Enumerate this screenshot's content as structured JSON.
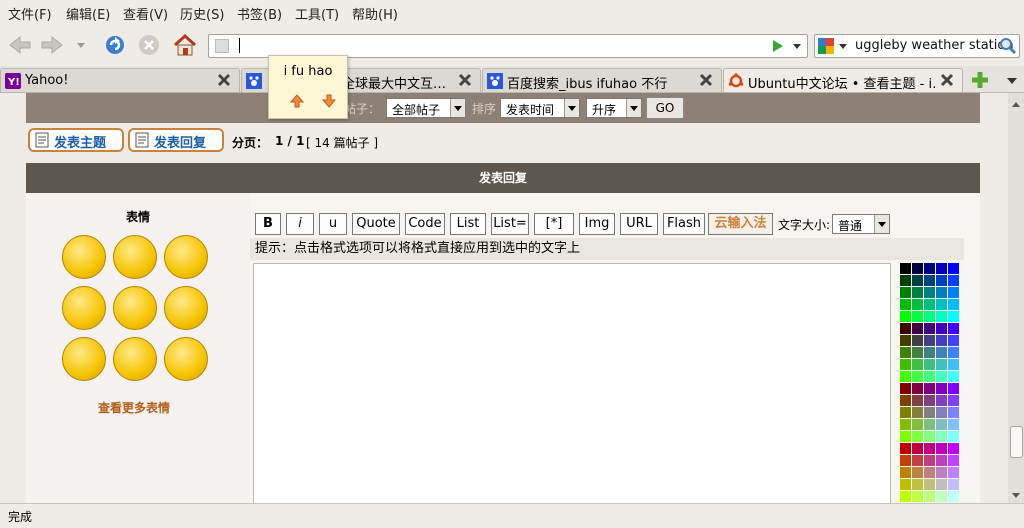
{
  "menu": [
    "文件(F)",
    "编辑(E)",
    "查看(V)",
    "历史(S)",
    "书签(B)",
    "工具(T)",
    "帮助(H)"
  ],
  "search": {
    "value": "uggleby weather station"
  },
  "tabs": [
    {
      "label": "Yahoo!"
    },
    {
      "label": "全球最大中文互…"
    },
    {
      "label": "百度搜索_ibus ifuhao 不行"
    },
    {
      "label": "Ubuntu中文论坛 • 查看主题 - i…"
    }
  ],
  "popup": {
    "text": "i fu hao"
  },
  "filter": {
    "label_posts": "帖子：",
    "posts_value": "全部帖子",
    "sort_label": "排序",
    "sort_value": "发表时间",
    "order_value": "升序",
    "go": "GO"
  },
  "actions": {
    "new_topic": "发表主题",
    "reply": "发表回复",
    "pagination_label": "分页：",
    "pagination_value": "1 / 1",
    "post_count": "[ 14 篇帖子 ]"
  },
  "reply_header": "发表回复",
  "smilies": {
    "title": "表情",
    "more": "查看更多表情"
  },
  "format_buttons": [
    "B",
    "i",
    "u",
    "Quote",
    "Code",
    "List",
    "List=",
    "[*]",
    "Img",
    "URL",
    "Flash",
    "云输入法"
  ],
  "font_size": {
    "label": "文字大小:",
    "value": "普通"
  },
  "hint": "提示：点击格式选项可以将格式直接应用到选中的文字上",
  "status": "完成",
  "colors": {
    "accent_orange": "#c9833c",
    "header_bar": "#5e574e",
    "top_strip": "#8c8174",
    "link_blue": "#1d5fa8"
  }
}
